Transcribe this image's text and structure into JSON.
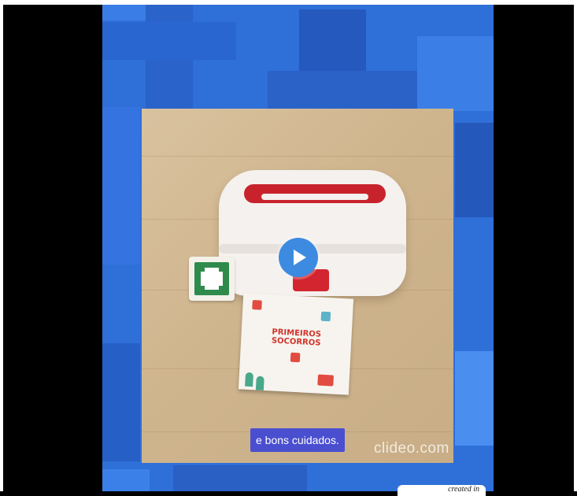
{
  "video": {
    "caption": "e bons cuidados.",
    "watermark": "clideo.com",
    "credit": "created in",
    "booklet_title": "PRIMEIROS SOCORROS"
  },
  "colors": {
    "background": "#2f6fd8",
    "caption_bg": "#4a4fcf",
    "play_button": "#3d8be0",
    "box_red": "#c8232c",
    "cross_green": "#2e8b4c"
  },
  "icons": {
    "play": "play-icon",
    "first_aid_cross": "first-aid-cross-icon"
  }
}
